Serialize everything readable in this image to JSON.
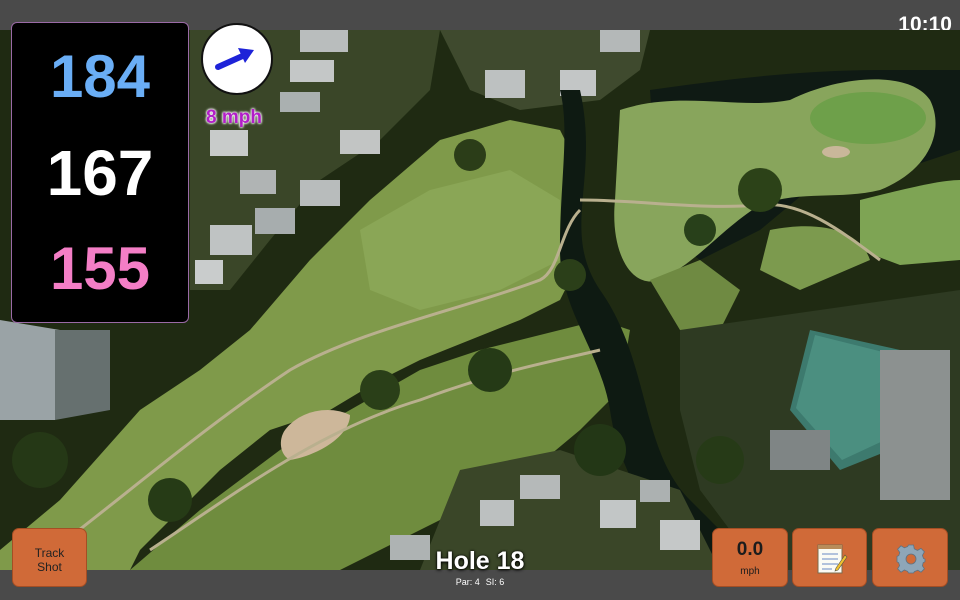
{
  "status": {
    "time": "10:10"
  },
  "distances": {
    "back": "184",
    "middle": "167",
    "front": "155"
  },
  "colors": {
    "back": "#6aaef6",
    "middle": "#ffffff",
    "front": "#f47ec6",
    "wind_speed": "#b21ec8",
    "button": "#d06a38"
  },
  "wind": {
    "speed": "8 mph",
    "icon": "arrow-northeast-icon"
  },
  "track_button": {
    "line1": "Track",
    "line2": "Shot"
  },
  "speed_button": {
    "value": "0.0",
    "unit": "mph"
  },
  "notes_button": {
    "icon": "notepad-icon"
  },
  "settings_button": {
    "icon": "gear-icon"
  },
  "hole": {
    "title": "Hole 18",
    "par": "Par: 4",
    "si": "SI: 6"
  }
}
